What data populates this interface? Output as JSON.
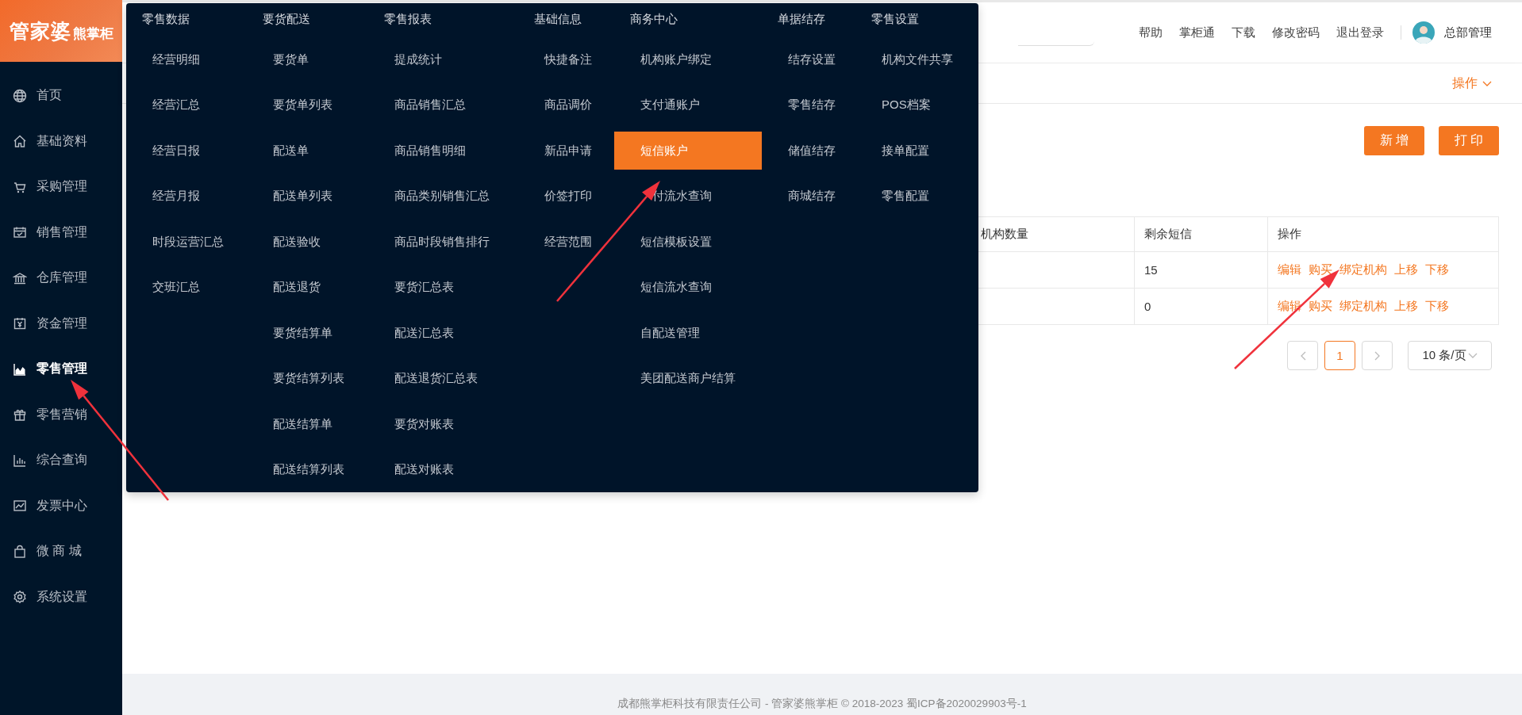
{
  "logo": {
    "brand": "管家婆",
    "product": "熊掌柜"
  },
  "sidebar": {
    "items": [
      {
        "label": "首页",
        "selected": false
      },
      {
        "label": "基础资料",
        "selected": false
      },
      {
        "label": "采购管理",
        "selected": false
      },
      {
        "label": "销售管理",
        "selected": false
      },
      {
        "label": "仓库管理",
        "selected": false
      },
      {
        "label": "资金管理",
        "selected": false
      },
      {
        "label": "零售管理",
        "selected": true
      },
      {
        "label": "零售营销",
        "selected": false
      },
      {
        "label": "综合查询",
        "selected": false
      },
      {
        "label": "发票中心",
        "selected": false
      },
      {
        "label": "微 商 城",
        "selected": false
      },
      {
        "label": "系统设置",
        "selected": false
      }
    ]
  },
  "header": {
    "links": [
      "帮助",
      "掌柜通",
      "下载",
      "修改密码",
      "退出登录"
    ],
    "user": "总部管理"
  },
  "subbar": {
    "operations": "操作"
  },
  "buttons": [
    "新 增",
    "打 印"
  ],
  "table": {
    "columns": [
      "机构数量",
      "剩余短信",
      "操作"
    ],
    "rows": [
      {
        "remaining": "15",
        "actions": [
          "编辑",
          "购买",
          "绑定机构",
          "上移",
          "下移"
        ]
      },
      {
        "remaining": "0",
        "actions": [
          "编辑",
          "购买",
          "绑定机构",
          "上移",
          "下移"
        ]
      }
    ]
  },
  "pagination": {
    "pages": [
      {
        "label": "1",
        "selected": true
      }
    ],
    "page_size": "10 条/页"
  },
  "mega_menu": {
    "columns": [
      {
        "title": "零售数据",
        "items": [
          {
            "label": "经营明细",
            "selected": false
          },
          {
            "label": "经营汇总",
            "selected": false
          },
          {
            "label": "经营日报",
            "selected": false
          },
          {
            "label": "经营月报",
            "selected": false
          },
          {
            "label": "时段运营汇总",
            "selected": false
          },
          {
            "label": "交班汇总",
            "selected": false
          }
        ]
      },
      {
        "title": "要货配送",
        "items": [
          {
            "label": "要货单",
            "selected": false
          },
          {
            "label": "要货单列表",
            "selected": false
          },
          {
            "label": "配送单",
            "selected": false
          },
          {
            "label": "配送单列表",
            "selected": false
          },
          {
            "label": "配送验收",
            "selected": false
          },
          {
            "label": "配送退货",
            "selected": false
          },
          {
            "label": "要货结算单",
            "selected": false
          },
          {
            "label": "要货结算列表",
            "selected": false
          },
          {
            "label": "配送结算单",
            "selected": false
          },
          {
            "label": "配送结算列表",
            "selected": false
          }
        ]
      },
      {
        "title": "零售报表",
        "items": [
          {
            "label": "提成统计",
            "selected": false
          },
          {
            "label": "商品销售汇总",
            "selected": false
          },
          {
            "label": "商品销售明细",
            "selected": false
          },
          {
            "label": "商品类别销售汇总",
            "selected": false
          },
          {
            "label": "商品时段销售排行",
            "selected": false
          },
          {
            "label": "要货汇总表",
            "selected": false
          },
          {
            "label": "配送汇总表",
            "selected": false
          },
          {
            "label": "配送退货汇总表",
            "selected": false
          },
          {
            "label": "要货对账表",
            "selected": false
          },
          {
            "label": "配送对账表",
            "selected": false
          }
        ]
      },
      {
        "title": "基础信息",
        "items": [
          {
            "label": "快捷备注",
            "selected": false
          },
          {
            "label": "商品调价",
            "selected": false
          },
          {
            "label": "新品申请",
            "selected": false
          },
          {
            "label": "价签打印",
            "selected": false
          },
          {
            "label": "经营范围",
            "selected": false
          }
        ]
      },
      {
        "title": "商务中心",
        "items": [
          {
            "label": "机构账户绑定",
            "selected": false
          },
          {
            "label": "支付通账户",
            "selected": false
          },
          {
            "label": "短信账户",
            "selected": true
          },
          {
            "label": "付流水查询",
            "selected": false
          },
          {
            "label": "短信模板设置",
            "selected": false
          },
          {
            "label": "短信流水查询",
            "selected": false
          },
          {
            "label": "自配送管理",
            "selected": false
          },
          {
            "label": "美团配送商户结算",
            "selected": false
          }
        ]
      },
      {
        "title": "单据结存",
        "items": [
          {
            "label": "结存设置",
            "selected": false
          },
          {
            "label": "零售结存",
            "selected": false
          },
          {
            "label": "储值结存",
            "selected": false
          },
          {
            "label": "商城结存",
            "selected": false
          }
        ]
      },
      {
        "title": "零售设置",
        "items": [
          {
            "label": "机构文件共享",
            "selected": false
          },
          {
            "label": "POS档案",
            "selected": false
          },
          {
            "label": "接单配置",
            "selected": false
          },
          {
            "label": "零售配置",
            "selected": false
          }
        ]
      }
    ]
  },
  "footer": "成都熊掌柜科技有限责任公司 - 管家婆熊掌柜 © 2018-2023 蜀ICP备2020029903号-1"
}
